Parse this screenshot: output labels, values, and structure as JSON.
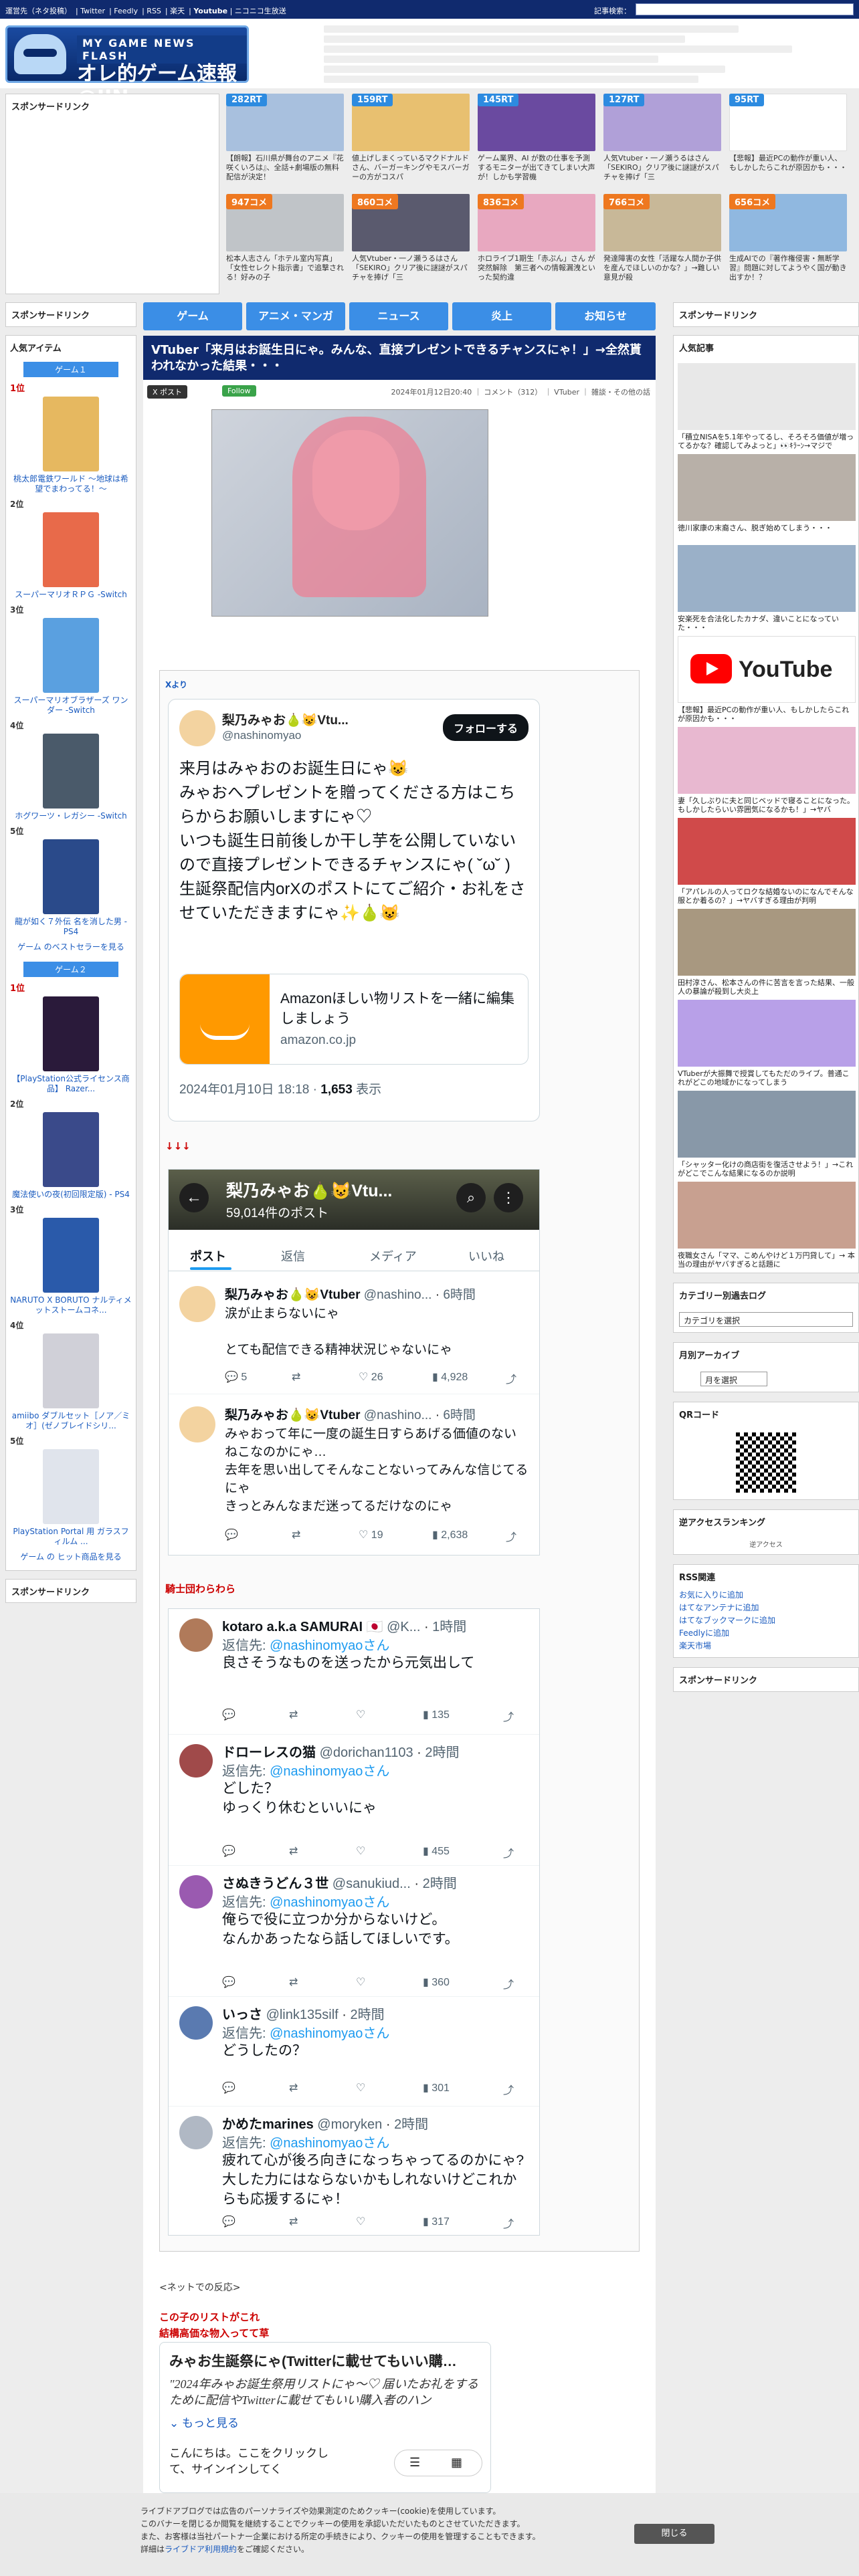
{
  "topbar": {
    "links": [
      "運営先（ネタ投稿）",
      "Twitter",
      "Feedly",
      "RSS",
      "楽天",
      "Youtube",
      "ニコニコ生放送"
    ],
    "search_label": "記事検索："
  },
  "logo": {
    "sub": "MY GAME NEWS FLASH",
    "main": "オレ的ゲーム速報@JIN"
  },
  "sponsor_title": "スポンサードリンク",
  "thumbs": [
    {
      "badge": "282RT",
      "type": "rt",
      "caption": "【朗報】石川県が舞台のアニメ『花咲くいろは』、全話+劇場版の無料配信が決定！"
    },
    {
      "badge": "159RT",
      "type": "rt",
      "caption": "値上げしまくっているマクドナルドさん、バーガーキングやモスバーガーの方がコスパ"
    },
    {
      "badge": "145RT",
      "type": "rt",
      "caption": "ゲーム業界、AI が数の仕事を予測するモニターが出てきてしまい大声が！しかも学習機"
    },
    {
      "badge": "127RT",
      "type": "rt",
      "caption": "人気Vtuber・一ノ瀬うるはさん「SEKIRO」クリア後に謎謎がスパチャを捧げ「三"
    },
    {
      "badge": "95RT",
      "type": "rt",
      "caption": "【悲報】最近PCの動作が重い人、もしかしたらこれが原因かも・・・"
    },
    {
      "badge": "947コメ",
      "type": "cm",
      "caption": "松本人志さん「ホテル室内写真」「女性セレクト指示書」で追撃される！好みの子"
    },
    {
      "badge": "860コメ",
      "type": "cm",
      "caption": "人気Vtuber・一ノ瀬うるはさん「SEKIRO」クリア後に謎謎がスパチャを捧げ「三"
    },
    {
      "badge": "836コメ",
      "type": "cm",
      "caption": "ホロライブ1期生「赤ぷん」さん が突然解除　第三者への情報漏洩といった契約違"
    },
    {
      "badge": "766コメ",
      "type": "cm",
      "caption": "発達障害の女性「活躍な人間か子供を産んでほしいのかな？」→難しい意見が殺"
    },
    {
      "badge": "656コメ",
      "type": "cm",
      "caption": "生成AIでの『著作権侵害・無断学習』問題に対してようやく国が動き出すか！？"
    }
  ],
  "nav": [
    "ゲーム",
    "アニメ・マンガ",
    "ニュース",
    "炎上",
    "お知らせ"
  ],
  "left": {
    "popular_title": "人気アイテム",
    "tab1": "ゲーム１",
    "games": [
      {
        "rank": "1位",
        "name": "桃太郎電鉄ワールド ～地球は希望でまわってる！～"
      },
      {
        "rank": "2位",
        "name": "スーパーマリオＲＰＧ -Switch"
      },
      {
        "rank": "3位",
        "name": "スーパーマリオブラザーズ ワンダー -Switch"
      },
      {
        "rank": "4位",
        "name": "ホグワーツ・レガシー -Switch"
      },
      {
        "rank": "5位",
        "name": "龍が如く７外伝 名を消した男 - PS4"
      }
    ],
    "more1": "ゲーム のベストセラーを見る",
    "tab2": "ゲーム２",
    "games2": [
      {
        "rank": "1位",
        "name": "【PlayStation公式ライセンス商品】 Razer..."
      },
      {
        "rank": "2位",
        "name": "魔法使いの夜(初回限定版) - PS4"
      },
      {
        "rank": "3位",
        "name": "NARUTO X BORUTO ナルティメットストームコネ..."
      },
      {
        "rank": "4位",
        "name": "amiibo ダブルセット［ノア／ミオ］(ゼノブレイドシリ..."
      },
      {
        "rank": "5位",
        "name": "PlayStation Portal 用 ガラスフィルム ..."
      }
    ],
    "more2": "ゲーム の ヒット商品を見る"
  },
  "article": {
    "title": "VTuber「来月はお誕生日にゃ。みんな、直接プレゼントできるチャンスにゃ！」→全然貰われなかった結果・・・",
    "x_label": "X ポスト",
    "follow_label": "Follow",
    "meta": "2024年01月12日20:40 ｜ コメント（312） ｜ VTuber ｜ 雑談・その他の話",
    "source": "Xより",
    "arrows": "↓↓↓",
    "knights": "騎士団わらわら",
    "net_reaction": "<ネットでの反応>",
    "red_lines": [
      "この子のリストがこれ",
      "結構高価な物入ってて草"
    ]
  },
  "tweet": {
    "name": "梨乃みゃお🍐😺Vtu...",
    "handle": "@nashinomyao",
    "follow": "フォローする",
    "body": "来月はみゃおのお誕生日にゃ😺\nみゃおへプレゼントを贈ってくださる方はこちらからお願いしますにゃ♡\nいつも誕生日前後しか干し芋を公開していないので直接プレゼントできるチャンスにゃ( ˘ω˘ )\n生誕祭配信内orXのポストにてご紹介・お礼をさせていただきますにゃ✨🍐😺",
    "card_title": "Amazonほしい物リストを一緒に編集しましょう",
    "card_domain": "amazon.co.jp",
    "time": "2024年01月10日 18:18 · ",
    "views": "1,653",
    "views_label": " 表示"
  },
  "profile": {
    "name": "梨乃みゃお🍐😺Vtu...",
    "posts": "59,014件のポスト",
    "tabs": [
      "ポスト",
      "返信",
      "メディア",
      "いいね"
    ],
    "items": [
      {
        "name": "梨乃みゃお🍐😺Vtuber",
        "handle": "@nashino...",
        "time": "6時間",
        "text": "涙が止まらないにゃ\n\nとても配信できる精神状況じゃないにゃ",
        "reply": "5",
        "like": "26",
        "views": "4,928"
      },
      {
        "name": "梨乃みゃお🍐😺Vtuber",
        "handle": "@nashino...",
        "time": "6時間",
        "text": "みゃおって年に一度の誕生日すらあげる価値のないねこなのかにゃ…\n去年を思い出してそんなことないってみんな信じてるにゃ\nきっとみんなまだ迷ってるだけなのにゃ",
        "reply": "",
        "like": "19",
        "views": "2,638"
      }
    ]
  },
  "replies": [
    {
      "name": "kotaro a.k.a SAMURAI 🇯🇵",
      "handle": "@K...",
      "time": "1時間",
      "to": "@nashinomyaoさん",
      "text": "良さそうなものを送ったから元気出して",
      "views": "135"
    },
    {
      "name": "ドローレスの猫",
      "handle": "@dorichan1103",
      "time": "2時間",
      "to": "@nashinomyaoさん",
      "text": "どした？\nゆっくり休むといいにゃ",
      "views": "455"
    },
    {
      "name": "さぬきうどん３世",
      "handle": "@sanukiud...",
      "time": "2時間",
      "to": "@nashinomyaoさん",
      "text": "俺らで役に立つか分からないけど。\nなんかあったなら話してほしいです。",
      "views": "360"
    },
    {
      "name": "いっさ",
      "handle": "@link135silf",
      "time": "2時間",
      "to": "@nashinomyaoさん",
      "text": "どうしたの？",
      "views": "301"
    },
    {
      "name": "かめたmarines",
      "handle": "@moryken",
      "time": "2時間",
      "to": "@nashinomyaoさん",
      "text": "疲れて心が後ろ向きになっちゃってるのかにゃ?大した力にはならないかもしれないけどこれからも応援するにゃ！",
      "views": "317"
    }
  ],
  "reply_prefix": "返信先: ",
  "embed": {
    "title": "みゃお生誕祭にゃ(Twitterに載せてもいい購…",
    "quote": "\"2024年みゃお誕生祭用リストにゃ〜♡ 届いたお礼をするために配信やTwitterに載せてもいい購入者のハン",
    "more": "もっと見る",
    "hello": "こんにちは。ここをクリックして、サインインしてく"
  },
  "right": {
    "sponsor": "スポンサードリンク",
    "popular": "人気記事",
    "articles": [
      "「積立NISAを5.1年やってるし、そろそろ価値が増ってるかな？確認してみよっと」👀ｷﾗｰﾝ→マジで",
      "徳川家康の末裔さん、脱ぎ始めてしまう・・・",
      "安楽死を合法化したカナダ、違いことになっていた・・・",
      "【悲報】最近PCの動作が重い人、もしかしたらこれが原因かも・・・",
      "妻「久しぶりに夫と同じベッドで寝ることになった。もしかしたらいい雰囲気になるかも！」→ヤバ",
      "「アパレルの人ってロクな結婚ないのになんでそんな服とか着るの？」→ヤバすぎる理由が判明",
      "田村淳さん、松本さんの件に苦言を言った結果、一般人の暴論が殺到し大炎上",
      "VTuberが大振舞で授賞してもただのライブ。普通これがどこの地域かになってしまう",
      "「シャッター化けの商店街を復活させよう！」→これがどこでこんな結果になるのか説明",
      "夜職女さん「ママ、こめんやけど１万円貸して」→ 本当の理由がヤバすぎると話題に"
    ],
    "category_title": "カテゴリー別過去ログ",
    "category_select": "カテゴリを選択",
    "archive_title": "月別アーカイブ",
    "archive_select": "月を選択",
    "qr_title": "QRコード",
    "ranking_title": "逆アクセスランキング",
    "ranking_text": "逆アクセス",
    "rss_title": "RSS関連",
    "rss_links": [
      "お気に入りに追加",
      "はてなアンテナに追加",
      "はてなブックマークに追加",
      "Feedlyに追加",
      "楽天市場"
    ],
    "sponsor2": "スポンサードリンク"
  },
  "cookie": {
    "line1": "ライブドアブログでは広告のパーソナライズや効果測定のためクッキー(cookie)を使用しています。",
    "line2": "このバナーを閉じるか閲覧を継続することでクッキーの使用を承認いただいたものとさせていただきます。",
    "line3": "また、お客様は当社パートナー企業における所定の手続きにより、クッキーの使用を管理することもできます。",
    "line4a": "詳細は",
    "link": "ライブドア利用規約",
    "line4b": "をご確認ください。",
    "close": "閉じる"
  }
}
